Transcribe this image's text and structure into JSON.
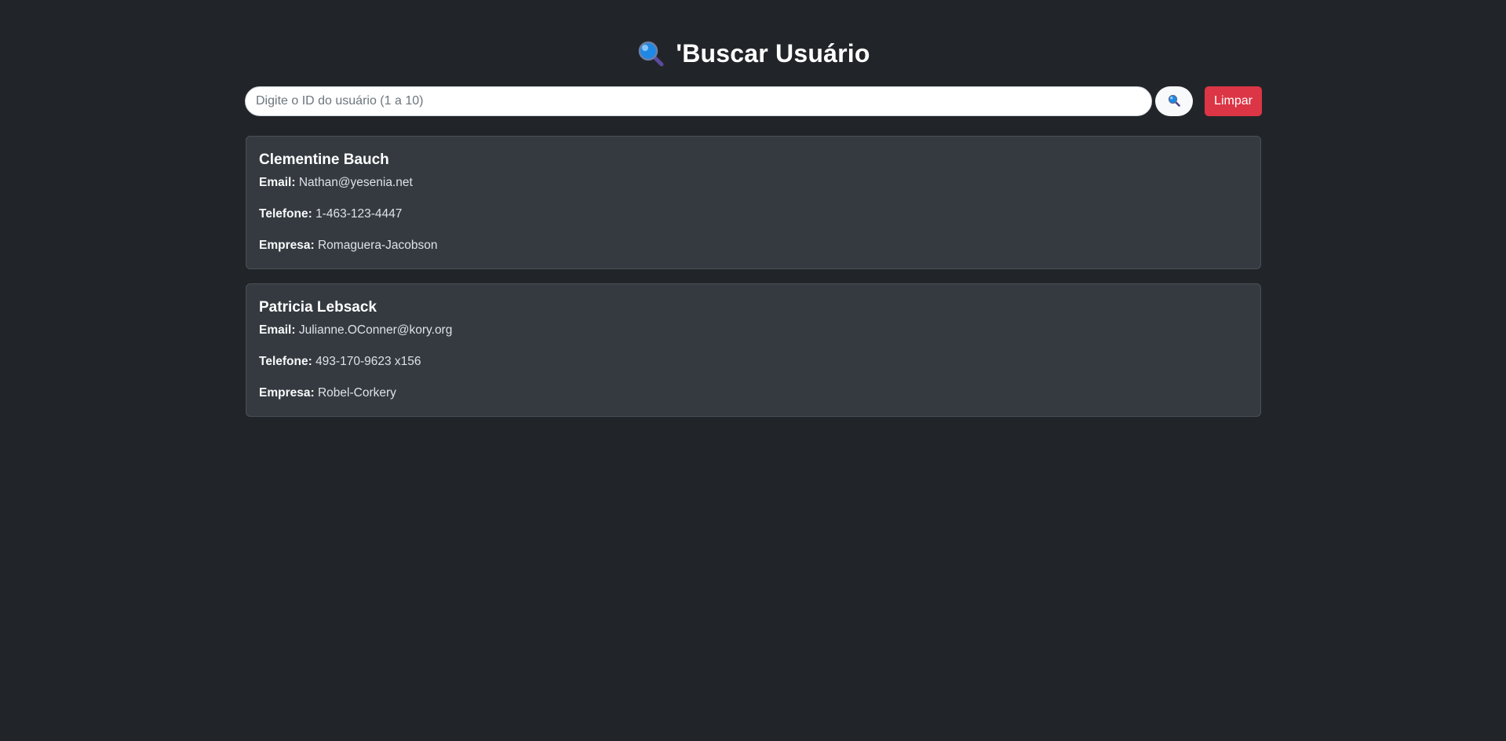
{
  "header": {
    "title": "'Buscar Usuário",
    "icon": "magnifying-glass-icon"
  },
  "search": {
    "value": "",
    "placeholder": "Digite o ID do usuário (1 a 10)",
    "search_button_icon": "magnifying-glass-icon",
    "clear_label": "Limpar"
  },
  "labels": {
    "email": "Email:",
    "phone": "Telefone:",
    "company": "Empresa:"
  },
  "users": [
    {
      "name": "Clementine Bauch",
      "email": "Nathan@yesenia.net",
      "phone": "1-463-123-4447",
      "company": "Romaguera-Jacobson"
    },
    {
      "name": "Patricia Lebsack",
      "email": "Julianne.OConner@kory.org",
      "phone": "493-170-9623 x156",
      "company": "Robel-Corkery"
    }
  ],
  "colors": {
    "background": "#212529",
    "card": "#343a40",
    "danger": "#dc3545",
    "icon_blue": "#1e88e5"
  }
}
